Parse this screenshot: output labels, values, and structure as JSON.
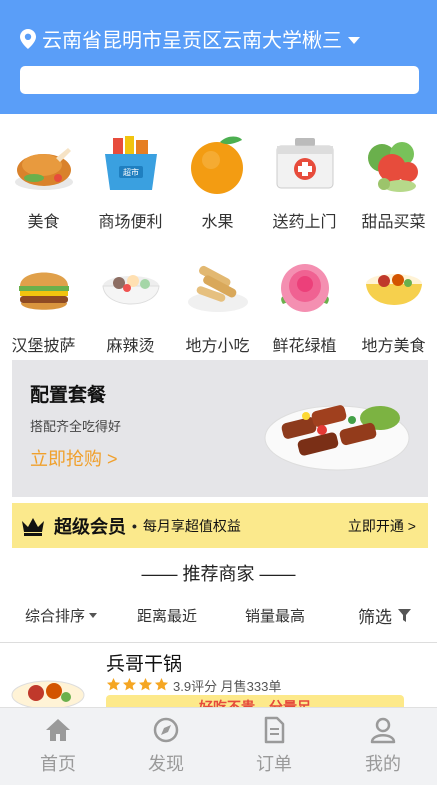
{
  "header": {
    "location": "云南省昆明市呈贡区云南大学楸三",
    "search_placeholder": ""
  },
  "categories": [
    {
      "label": "美食",
      "icon": "roast-chicken-icon"
    },
    {
      "label": "商场便利",
      "icon": "shopping-basket-icon"
    },
    {
      "label": "水果",
      "icon": "orange-icon"
    },
    {
      "label": "送药上门",
      "icon": "medicine-box-icon"
    },
    {
      "label": "甜品买菜",
      "icon": "vegetables-icon"
    },
    {
      "label": "汉堡披萨",
      "icon": "hamburger-icon"
    },
    {
      "label": "麻辣烫",
      "icon": "spicy-hotpot-bowl-icon"
    },
    {
      "label": "地方小吃",
      "icon": "spring-rolls-icon"
    },
    {
      "label": "鲜花绿植",
      "icon": "rose-icon"
    },
    {
      "label": "地方美食",
      "icon": "rice-bowl-icon"
    }
  ],
  "promo": {
    "title": "配置套餐",
    "subtitle": "搭配齐全吃得好",
    "cta": "立即抢购 >"
  },
  "vip": {
    "title": "超级会员",
    "bullet": "•",
    "subtitle": "每月享超值权益",
    "button": "立即开通 >"
  },
  "section": {
    "title": "—— 推荐商家 ——"
  },
  "filters": {
    "sort": "综合排序",
    "distance": "距离最近",
    "sales": "销量最高",
    "filter": "筛选"
  },
  "shop": {
    "name": "兵哥干锅",
    "stars": 4,
    "rating_text": "3.9评分 月售333单",
    "tag": "好吃不贵，分量足"
  },
  "tabbar": [
    {
      "label": "首页",
      "icon": "home-icon"
    },
    {
      "label": "发现",
      "icon": "compass-icon"
    },
    {
      "label": "订单",
      "icon": "document-icon"
    },
    {
      "label": "我的",
      "icon": "user-icon"
    }
  ],
  "colors": {
    "header_bg": "#5a9ef8",
    "vip_bg": "#fbe98c",
    "cta": "#f0a02c",
    "star": "#f5a623",
    "tag_text": "#e54b3c"
  }
}
